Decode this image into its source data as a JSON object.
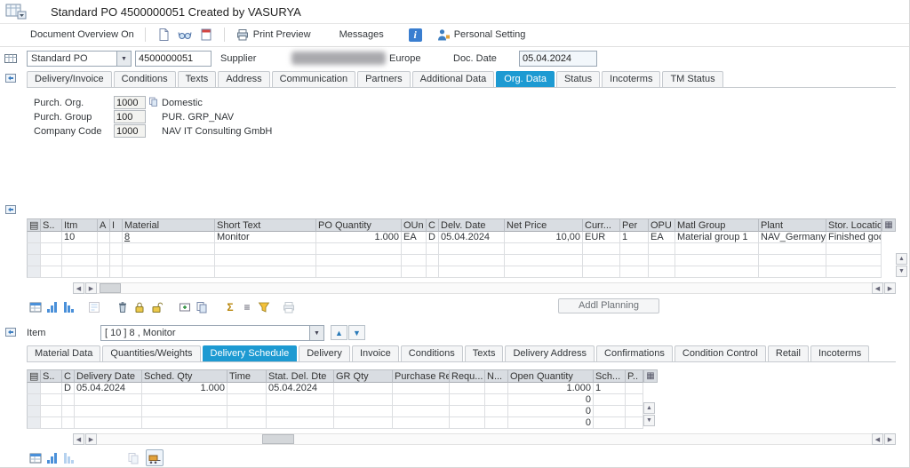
{
  "theme": {
    "active_tab_bg": "#1d9ad2",
    "active_tab_text": "#ffffff",
    "grid_header_bg": "#d9dde2",
    "info_icon_bg": "#3a7ed0"
  },
  "window": {
    "title": "Standard PO 4500000051 Created by VASURYA"
  },
  "toolbar": {
    "document_overview_label": "Document Overview On",
    "print_preview_label": "Print Preview",
    "messages_label": "Messages",
    "personal_setting_label": "Personal Setting"
  },
  "header": {
    "order_type": "Standard PO",
    "po_number": "4500000051",
    "supplier_label": "Supplier",
    "supplier_region": "Europe",
    "doc_date_label": "Doc. Date",
    "doc_date_value": "05.04.2024",
    "tabs": [
      "Delivery/Invoice",
      "Conditions",
      "Texts",
      "Address",
      "Communication",
      "Partners",
      "Additional Data",
      "Org. Data",
      "Status",
      "Incoterms",
      "TM Status"
    ],
    "active_tab": "Org. Data"
  },
  "org_data": {
    "fields": [
      {
        "label": "Purch. Org.",
        "value": "1000",
        "description": "Domestic"
      },
      {
        "label": "Purch. Group",
        "value": "100",
        "description": "PUR. GRP_NAV"
      },
      {
        "label": "Company Code",
        "value": "1000",
        "description": "NAV IT Consulting GmbH"
      }
    ]
  },
  "item_grid": {
    "columns": [
      "",
      "S..",
      "Itm",
      "A",
      "I",
      "Material",
      "Short Text",
      "PO Quantity",
      "OUn",
      "C",
      "Delv. Date",
      "Net Price",
      "Curr...",
      "Per",
      "OPU",
      "Matl Group",
      "Plant",
      "Stor. Location"
    ],
    "rows": [
      [
        "",
        "",
        "10",
        "",
        "",
        "8",
        "Monitor",
        "1.000",
        "EA",
        "D",
        "05.04.2024",
        "10,00",
        "EUR",
        "1",
        "EA",
        "Material group 1",
        "NAV_Germany",
        "Finished goods"
      ],
      [
        "",
        "",
        "",
        "",
        "",
        "",
        "",
        "",
        "",
        "",
        "",
        "",
        "",
        "",
        "",
        "",
        "",
        ""
      ],
      [
        "",
        "",
        "",
        "",
        "",
        "",
        "",
        "",
        "",
        "",
        "",
        "",
        "",
        "",
        "",
        "",
        "",
        ""
      ],
      [
        "",
        "",
        "",
        "",
        "",
        "",
        "",
        "",
        "",
        "",
        "",
        "",
        "",
        "",
        "",
        "",
        "",
        ""
      ]
    ],
    "addl_planning_label": "Addl Planning"
  },
  "item_detail": {
    "item_label": "Item",
    "item_selector_value": "[ 10 ] 8 , Monitor",
    "tabs": [
      "Material Data",
      "Quantities/Weights",
      "Delivery Schedule",
      "Delivery",
      "Invoice",
      "Conditions",
      "Texts",
      "Delivery Address",
      "Confirmations",
      "Condition Control",
      "Retail",
      "Incoterms"
    ],
    "active_tab": "Delivery Schedule"
  },
  "schedule_grid": {
    "columns": [
      "",
      "S..",
      "C",
      "Delivery Date",
      "Sched. Qty",
      "Time",
      "Stat. Del. Dte",
      "GR Qty",
      "Purchase Req.",
      "Requ...",
      "N...",
      "Open Quantity",
      "Sch...",
      "P.."
    ],
    "rows": [
      [
        "",
        "",
        "D",
        "05.04.2024",
        "1.000",
        "",
        "05.04.2024",
        "",
        "",
        "",
        "",
        "1.000",
        "1",
        ""
      ],
      [
        "",
        "",
        "",
        "",
        "",
        "",
        "",
        "",
        "",
        "",
        "",
        "0",
        "",
        ""
      ],
      [
        "",
        "",
        "",
        "",
        "",
        "",
        "",
        "",
        "",
        "",
        "",
        "0",
        "",
        ""
      ],
      [
        "",
        "",
        "",
        "",
        "",
        "",
        "",
        "",
        "",
        "",
        "",
        "0",
        "",
        ""
      ]
    ]
  },
  "icons": {
    "select_all": "▤",
    "grid_config": "▦",
    "dropdown_arrow": "▼",
    "nav_up": "▲",
    "nav_down": "▼",
    "scroll_left": "◀",
    "scroll_right": "▶",
    "scroll_up": "▲",
    "scroll_down": "▼",
    "sum": "Σ",
    "subtotal": "≡",
    "info": "i"
  }
}
